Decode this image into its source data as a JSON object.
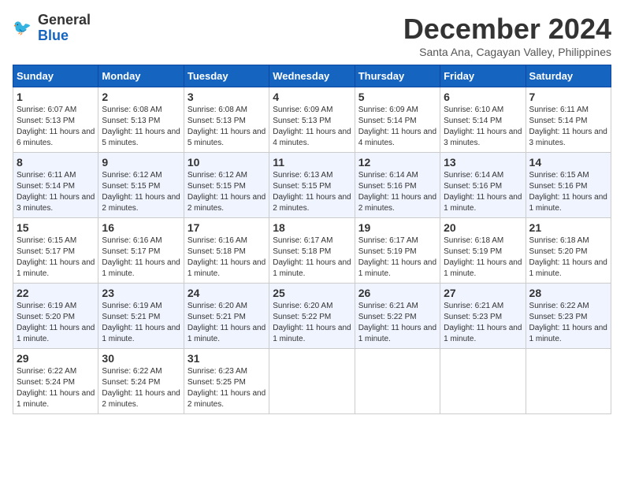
{
  "logo": {
    "text_general": "General",
    "text_blue": "Blue"
  },
  "header": {
    "month": "December 2024",
    "location": "Santa Ana, Cagayan Valley, Philippines"
  },
  "columns": [
    "Sunday",
    "Monday",
    "Tuesday",
    "Wednesday",
    "Thursday",
    "Friday",
    "Saturday"
  ],
  "weeks": [
    [
      {
        "day": "1",
        "sunrise": "6:07 AM",
        "sunset": "5:13 PM",
        "daylight": "11 hours and 6 minutes."
      },
      {
        "day": "2",
        "sunrise": "6:08 AM",
        "sunset": "5:13 PM",
        "daylight": "11 hours and 5 minutes."
      },
      {
        "day": "3",
        "sunrise": "6:08 AM",
        "sunset": "5:13 PM",
        "daylight": "11 hours and 5 minutes."
      },
      {
        "day": "4",
        "sunrise": "6:09 AM",
        "sunset": "5:13 PM",
        "daylight": "11 hours and 4 minutes."
      },
      {
        "day": "5",
        "sunrise": "6:09 AM",
        "sunset": "5:14 PM",
        "daylight": "11 hours and 4 minutes."
      },
      {
        "day": "6",
        "sunrise": "6:10 AM",
        "sunset": "5:14 PM",
        "daylight": "11 hours and 3 minutes."
      },
      {
        "day": "7",
        "sunrise": "6:11 AM",
        "sunset": "5:14 PM",
        "daylight": "11 hours and 3 minutes."
      }
    ],
    [
      {
        "day": "8",
        "sunrise": "6:11 AM",
        "sunset": "5:14 PM",
        "daylight": "11 hours and 3 minutes."
      },
      {
        "day": "9",
        "sunrise": "6:12 AM",
        "sunset": "5:15 PM",
        "daylight": "11 hours and 2 minutes."
      },
      {
        "day": "10",
        "sunrise": "6:12 AM",
        "sunset": "5:15 PM",
        "daylight": "11 hours and 2 minutes."
      },
      {
        "day": "11",
        "sunrise": "6:13 AM",
        "sunset": "5:15 PM",
        "daylight": "11 hours and 2 minutes."
      },
      {
        "day": "12",
        "sunrise": "6:14 AM",
        "sunset": "5:16 PM",
        "daylight": "11 hours and 2 minutes."
      },
      {
        "day": "13",
        "sunrise": "6:14 AM",
        "sunset": "5:16 PM",
        "daylight": "11 hours and 1 minute."
      },
      {
        "day": "14",
        "sunrise": "6:15 AM",
        "sunset": "5:16 PM",
        "daylight": "11 hours and 1 minute."
      }
    ],
    [
      {
        "day": "15",
        "sunrise": "6:15 AM",
        "sunset": "5:17 PM",
        "daylight": "11 hours and 1 minute."
      },
      {
        "day": "16",
        "sunrise": "6:16 AM",
        "sunset": "5:17 PM",
        "daylight": "11 hours and 1 minute."
      },
      {
        "day": "17",
        "sunrise": "6:16 AM",
        "sunset": "5:18 PM",
        "daylight": "11 hours and 1 minute."
      },
      {
        "day": "18",
        "sunrise": "6:17 AM",
        "sunset": "5:18 PM",
        "daylight": "11 hours and 1 minute."
      },
      {
        "day": "19",
        "sunrise": "6:17 AM",
        "sunset": "5:19 PM",
        "daylight": "11 hours and 1 minute."
      },
      {
        "day": "20",
        "sunrise": "6:18 AM",
        "sunset": "5:19 PM",
        "daylight": "11 hours and 1 minute."
      },
      {
        "day": "21",
        "sunrise": "6:18 AM",
        "sunset": "5:20 PM",
        "daylight": "11 hours and 1 minute."
      }
    ],
    [
      {
        "day": "22",
        "sunrise": "6:19 AM",
        "sunset": "5:20 PM",
        "daylight": "11 hours and 1 minute."
      },
      {
        "day": "23",
        "sunrise": "6:19 AM",
        "sunset": "5:21 PM",
        "daylight": "11 hours and 1 minute."
      },
      {
        "day": "24",
        "sunrise": "6:20 AM",
        "sunset": "5:21 PM",
        "daylight": "11 hours and 1 minute."
      },
      {
        "day": "25",
        "sunrise": "6:20 AM",
        "sunset": "5:22 PM",
        "daylight": "11 hours and 1 minute."
      },
      {
        "day": "26",
        "sunrise": "6:21 AM",
        "sunset": "5:22 PM",
        "daylight": "11 hours and 1 minute."
      },
      {
        "day": "27",
        "sunrise": "6:21 AM",
        "sunset": "5:23 PM",
        "daylight": "11 hours and 1 minute."
      },
      {
        "day": "28",
        "sunrise": "6:22 AM",
        "sunset": "5:23 PM",
        "daylight": "11 hours and 1 minute."
      }
    ],
    [
      {
        "day": "29",
        "sunrise": "6:22 AM",
        "sunset": "5:24 PM",
        "daylight": "11 hours and 1 minute."
      },
      {
        "day": "30",
        "sunrise": "6:22 AM",
        "sunset": "5:24 PM",
        "daylight": "11 hours and 2 minutes."
      },
      {
        "day": "31",
        "sunrise": "6:23 AM",
        "sunset": "5:25 PM",
        "daylight": "11 hours and 2 minutes."
      },
      null,
      null,
      null,
      null
    ]
  ],
  "labels": {
    "sunrise": "Sunrise:",
    "sunset": "Sunset:",
    "daylight": "Daylight:"
  }
}
